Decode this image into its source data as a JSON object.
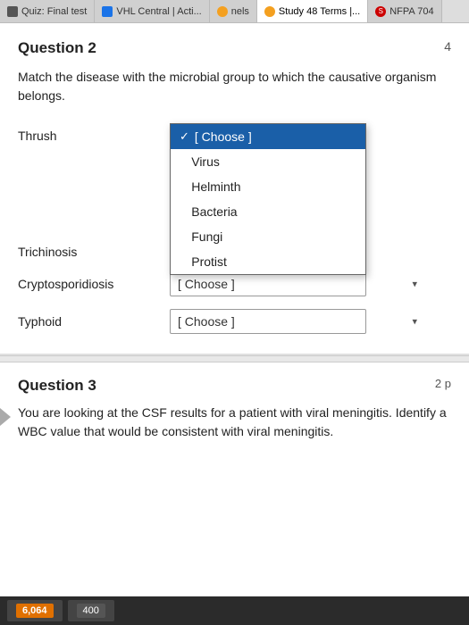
{
  "tabs": [
    {
      "label": "Quiz: Final test",
      "active": false,
      "id": "quiz-tab"
    },
    {
      "label": "VHL Central | Acti...",
      "active": false,
      "id": "vhl-tab"
    },
    {
      "label": "nels",
      "active": false,
      "id": "nels-tab"
    },
    {
      "label": "Study 48 Terms |...",
      "active": true,
      "id": "study-tab"
    },
    {
      "label": "NFPA 704",
      "active": false,
      "id": "nfpa-tab"
    }
  ],
  "question2": {
    "title": "Question 2",
    "number_right": "4",
    "instruction": "Match the disease with the microbial group to which the causative organism belongs.",
    "rows": [
      {
        "label": "Thrush",
        "id": "thrush"
      },
      {
        "label": "Trichinosis",
        "id": "trichinosis"
      },
      {
        "label": "Cryptosporidiosis",
        "id": "cryptosporidiosis"
      },
      {
        "label": "Typhoid",
        "id": "typhoid"
      }
    ],
    "dropdown": {
      "items": [
        {
          "label": "[ Choose ]",
          "selected": true
        },
        {
          "label": "Virus",
          "selected": false
        },
        {
          "label": "Helminth",
          "selected": false
        },
        {
          "label": "Bacteria",
          "selected": false
        },
        {
          "label": "Fungi",
          "selected": false
        },
        {
          "label": "Protist",
          "selected": false
        }
      ]
    },
    "choose_label": "[ Choose ]"
  },
  "question3": {
    "title": "Question 3",
    "number_right": "2 p",
    "text": "You are looking at the CSF results for a patient with viral meningitis.  Identify a WBC value that would be consistent with viral meningitis."
  },
  "taskbar": {
    "btn1": "6,064",
    "btn2": "400"
  }
}
